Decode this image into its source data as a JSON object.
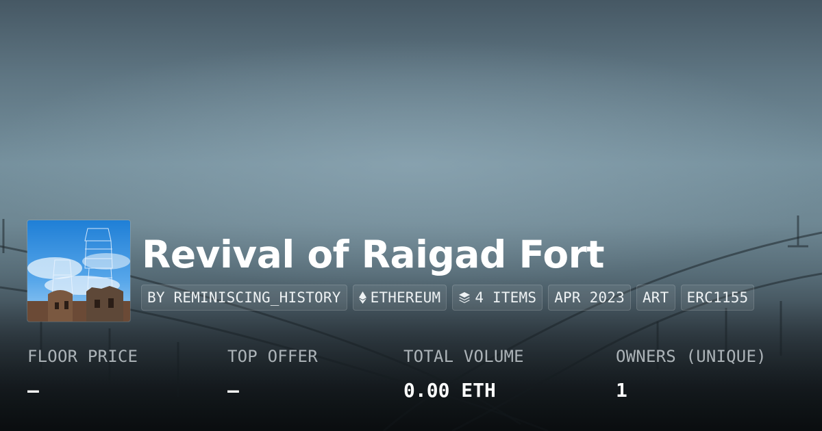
{
  "collection": {
    "title": "Revival of Raigad Fort",
    "thumbnail_icon": "fort-artwork-image"
  },
  "tags": [
    {
      "label": "BY REMINISCING_HISTORY"
    },
    {
      "label": "ETHEREUM",
      "icon": "ethereum-icon"
    },
    {
      "label": "4 ITEMS",
      "icon": "layers-icon"
    },
    {
      "label": "APR 2023"
    },
    {
      "label": "ART"
    },
    {
      "label": "ERC1155"
    }
  ],
  "stats": [
    {
      "label": "FLOOR PRICE",
      "value": "–"
    },
    {
      "label": "TOP OFFER",
      "value": "–"
    },
    {
      "label": "TOTAL VOLUME",
      "value": "0.00 ETH"
    },
    {
      "label": "OWNERS (UNIQUE)",
      "value": "1"
    }
  ],
  "colors": {
    "text": "#ffffff",
    "muted_text": "#e1e8ec",
    "sky_top": "#465864",
    "sky_mid": "#75909d",
    "bottom": "#12181c"
  }
}
